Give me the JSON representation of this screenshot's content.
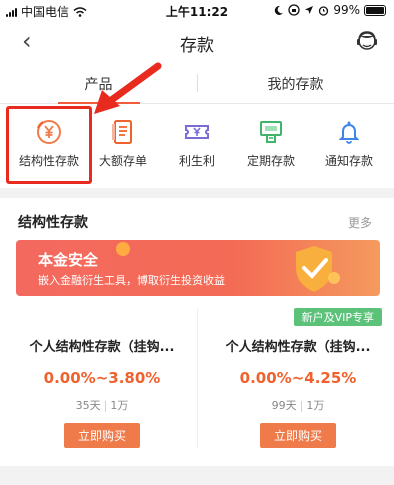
{
  "status": {
    "carrier": "中国电信",
    "time": "上午11:22",
    "battery": "99%",
    "battery_level": 0.99
  },
  "nav": {
    "back": "‹",
    "title": "存款"
  },
  "tabs": [
    {
      "label": "产品"
    },
    {
      "label": "我的存款"
    }
  ],
  "categories": [
    {
      "label": "结构性存款",
      "icon": "yen-coin-icon",
      "color": "#f07b4a"
    },
    {
      "label": "大额存单",
      "icon": "certificate-icon",
      "color": "#f0622d"
    },
    {
      "label": "利生利",
      "icon": "yen-ticket-icon",
      "color": "#7a6cd6"
    },
    {
      "label": "定期存款",
      "icon": "deposit-box-icon",
      "color": "#3fb56a"
    },
    {
      "label": "通知存款",
      "icon": "bell-icon",
      "color": "#3d86e6"
    }
  ],
  "section": {
    "title": "结构性存款",
    "more": "更多",
    "banner": {
      "title": "本金安全",
      "subtitle": "嵌入金融衍生工具，博取衍生投资收益"
    },
    "vip_tag": "新户及VIP专享",
    "products": [
      {
        "name": "个人结构性存款（挂钩...",
        "rate": "0.00%~3.80%",
        "term": "35天",
        "min": "1万",
        "button": "立即购买"
      },
      {
        "name": "个人结构性存款（挂钩...",
        "rate": "0.00%~4.25%",
        "term": "99天",
        "min": "1万",
        "button": "立即购买"
      }
    ]
  },
  "colors": {
    "accent": "#f0622d",
    "highlight": "#e82a1f",
    "vip": "#5cc27a"
  }
}
